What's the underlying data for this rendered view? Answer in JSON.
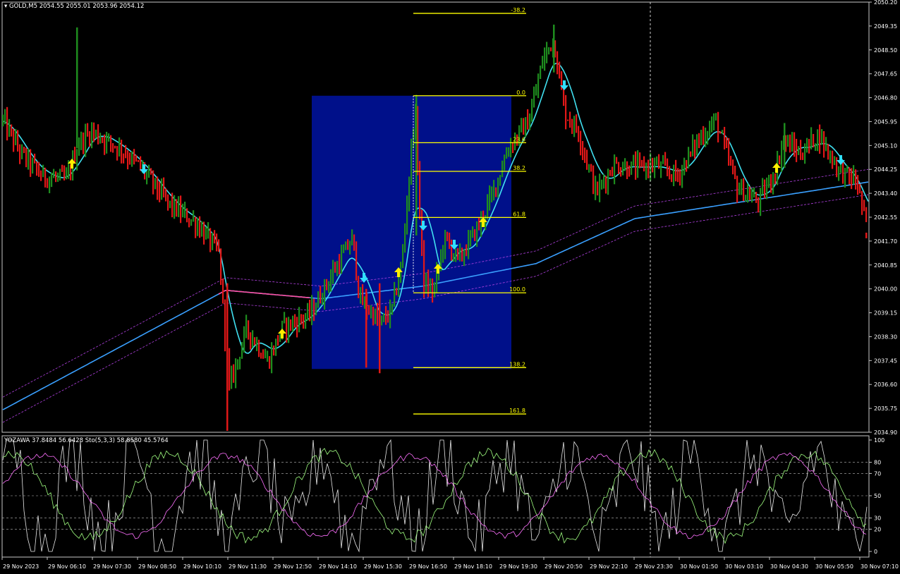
{
  "window": {
    "symbol_header": "GOLD,M5  2054.55 2055.01 2053.96 2054.12",
    "indicator_header": "YOZAWA 37.8484 56.6428  Sto(5,3,3) 58.8580 45.5764"
  },
  "price_axis": {
    "labels": [
      "2050.20",
      "2049.35",
      "2048.50",
      "2047.65",
      "2046.80",
      "2045.95",
      "2045.10",
      "2044.25",
      "2043.40",
      "2042.55",
      "2041.70",
      "2040.85",
      "2040.00",
      "2039.15",
      "2038.30",
      "2037.45",
      "2036.60",
      "2035.75",
      "2034.90"
    ],
    "min": 2034.9,
    "max": 2050.2
  },
  "osc_axis": {
    "labels": [
      "100",
      "80",
      "70",
      "50",
      "30",
      "20",
      "0"
    ],
    "levels": [
      80,
      70,
      50,
      30,
      20
    ]
  },
  "time_axis": {
    "labels": [
      "29 Nov 2023",
      "29 Nov 06:10",
      "29 Nov 07:30",
      "29 Nov 08:50",
      "29 Nov 10:10",
      "29 Nov 11:30",
      "29 Nov 12:50",
      "29 Nov 14:10",
      "29 Nov 15:30",
      "29 Nov 16:50",
      "29 Nov 18:10",
      "29 Nov 19:30",
      "29 Nov 20:50",
      "29 Nov 22:10",
      "29 Nov 23:30",
      "30 Nov 01:50",
      "30 Nov 03:10",
      "30 Nov 04:30",
      "30 Nov 05:50",
      "30 Nov 07:10"
    ]
  },
  "fibonacci": {
    "levels": [
      {
        "label": "-38.2",
        "price": 2049.8
      },
      {
        "label": "0.0",
        "price": 2046.87
      },
      {
        "label": "23.6",
        "price": 2045.2
      },
      {
        "label": "38.2",
        "price": 2044.18
      },
      {
        "label": "61.8",
        "price": 2042.54
      },
      {
        "label": "100.0",
        "price": 2039.86
      },
      {
        "label": "138.2",
        "price": 2037.2
      },
      {
        "label": "161.8",
        "price": 2035.55
      }
    ],
    "color": "#ffff00",
    "zone_color": "#00108a",
    "zone_top_price": 2046.87,
    "zone_bottom_price": 2037.15
  },
  "colors": {
    "background": "#000000",
    "bull_bar": "#1e8c1e",
    "bear_bar": "#e01818",
    "fast_ma": "#40e0f0",
    "slow_ma": "#3aa0ff",
    "slow_ma_flat": "#ff4fa0",
    "envelope": "#b040e0",
    "up_arrow": "#ffee00",
    "down_arrow": "#30e0ff",
    "grid_dash": "#bbbbbb",
    "stoch_main": "#a0ff80",
    "stoch_signal": "#ff70ff",
    "yozawa": "#e8e8e8"
  }
}
